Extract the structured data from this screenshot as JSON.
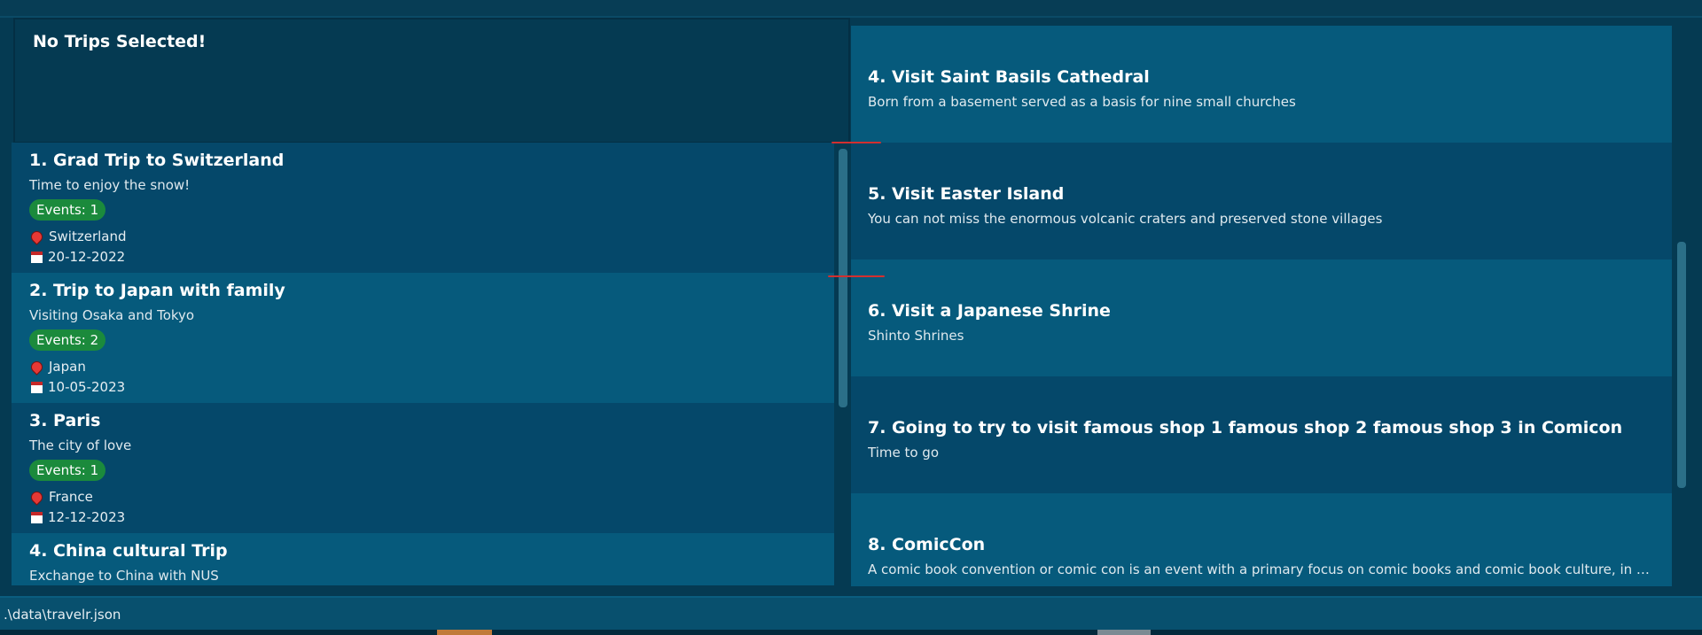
{
  "detail": {
    "title": "No Trips Selected!"
  },
  "trips": [
    {
      "title": "1.  Grad Trip to Switzerland",
      "desc": "Time to enjoy the snow!",
      "events": "Events: 1",
      "location": "Switzerland",
      "date": "20-12-2022"
    },
    {
      "title": "2.  Trip to Japan with family",
      "desc": "Visiting Osaka and Tokyo",
      "events": "Events: 2",
      "location": "Japan",
      "date": "10-05-2023"
    },
    {
      "title": "3.  Paris",
      "desc": "The city of love",
      "events": "Events: 1",
      "location": "France",
      "date": "12-12-2023"
    },
    {
      "title": "4.  China cultural Trip",
      "desc": "Exchange to China with NUS"
    }
  ],
  "events": [
    {
      "title": "4.  Visit Saint Basils Cathedral",
      "desc": "Born from a basement served as a basis for nine small churches"
    },
    {
      "title": "5.  Visit Easter Island",
      "desc": "You can not miss the enormous volcanic craters and preserved stone villages"
    },
    {
      "title": "6.  Visit a Japanese Shrine",
      "desc": "Shinto Shrines"
    },
    {
      "title": "7.  Going to try to visit famous shop 1 famous shop 2 famous shop 3 in Comicon",
      "desc": "Time to go"
    },
    {
      "title": "8.  ComicCon",
      "desc": "A comic book convention or comic con is an event with a primary focus on comic books and comic book culture, in which c..."
    }
  ],
  "status": {
    "path": ".\\data\\travelr.json"
  },
  "icons": {
    "location": "map-pin-icon",
    "date": "calendar-icon"
  },
  "colors": {
    "background": "#053a52",
    "card_light": "#065a7c",
    "card_dark": "#05486a",
    "badge": "#1b8a3c"
  }
}
